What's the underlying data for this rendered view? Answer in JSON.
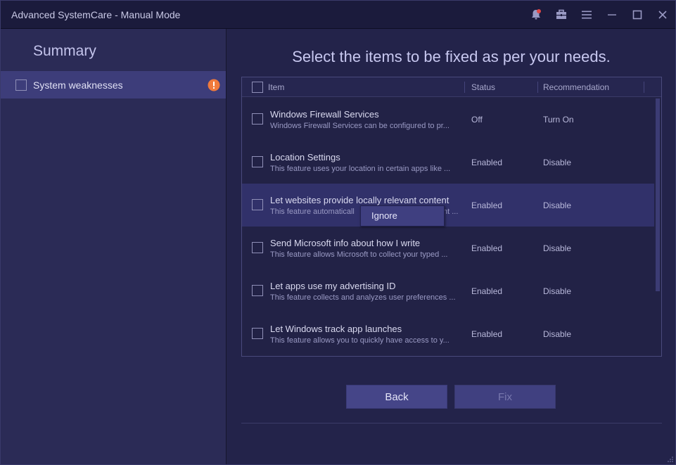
{
  "window": {
    "title": "Advanced SystemCare - Manual Mode"
  },
  "titlebar_icons": [
    "notification-bell-icon",
    "toolbox-icon",
    "menu-icon",
    "minimize-icon",
    "maximize-icon",
    "close-icon"
  ],
  "colors": {
    "accent": "#3d3d7a",
    "warning": "#f07a3c",
    "notification_dot": "#e04848"
  },
  "sidebar": {
    "title": "Summary",
    "items": [
      {
        "label": "System weaknesses",
        "checked": false,
        "warning": true
      }
    ]
  },
  "main": {
    "heading": "Select the items to be fixed as per your needs.",
    "table": {
      "columns": [
        "Item",
        "Status",
        "Recommendation"
      ],
      "rows": [
        {
          "title": "Windows Firewall Services",
          "desc": "Windows Firewall Services can be configured to pr...",
          "status": "Off",
          "recommendation": "Turn On"
        },
        {
          "title": "Location Settings",
          "desc": "This feature uses your location in certain apps like ...",
          "status": "Enabled",
          "recommendation": "Disable"
        },
        {
          "title": "Let websites provide locally relevant content",
          "desc": "This feature automaticall",
          "desc_tail": "nt ...",
          "status": "Enabled",
          "recommendation": "Disable"
        },
        {
          "title": "Send Microsoft info about how I write",
          "desc": "This feature allows Microsoft to collect your typed ...",
          "status": "Enabled",
          "recommendation": "Disable"
        },
        {
          "title": "Let apps use my advertising ID",
          "desc": "This feature collects and analyzes user preferences ...",
          "status": "Enabled",
          "recommendation": "Disable"
        },
        {
          "title": "Let Windows track app launches",
          "desc": "This feature allows you to quickly have access to y...",
          "status": "Enabled",
          "recommendation": "Disable"
        }
      ]
    },
    "context_menu": {
      "items": [
        "Ignore"
      ]
    },
    "buttons": {
      "back": "Back",
      "fix": "Fix"
    }
  }
}
